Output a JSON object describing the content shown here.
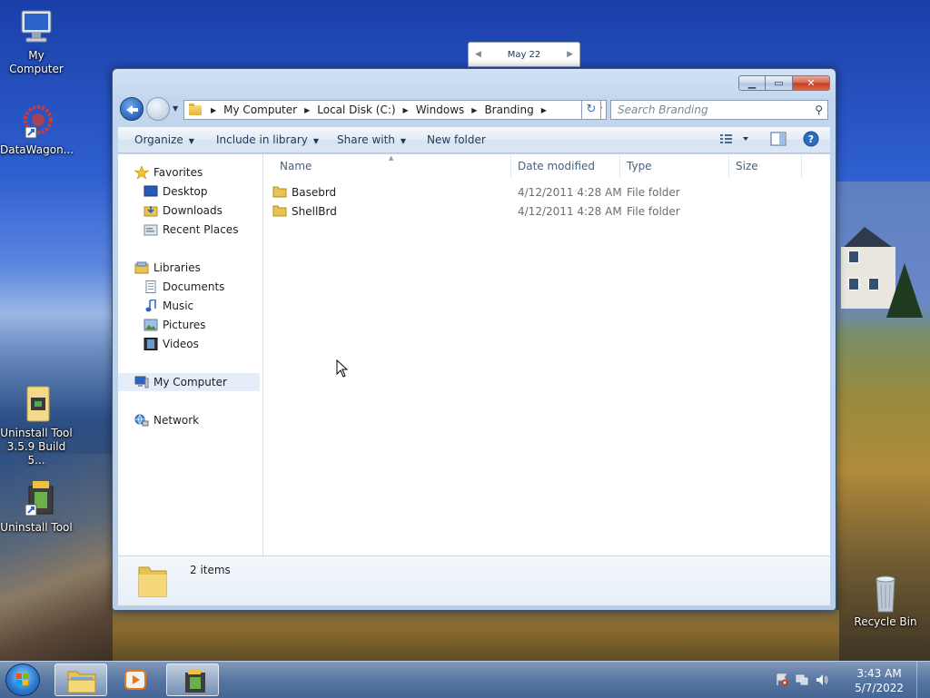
{
  "desktop": {
    "icons": [
      {
        "label": "My Computer"
      },
      {
        "label": "DataWagon..."
      },
      {
        "label": "Uninstall Tool 3.5.9 Build 5..."
      },
      {
        "label": "Uninstall Tool"
      },
      {
        "label": "Recycle Bin"
      }
    ]
  },
  "calendar": {
    "month": "May 22"
  },
  "window": {
    "breadcrumb": [
      "My Computer",
      "Local Disk (C:)",
      "Windows",
      "Branding"
    ],
    "search_placeholder": "Search Branding",
    "toolbar": {
      "organize": "Organize",
      "include_in_library": "Include in library",
      "share_with": "Share with",
      "new_folder": "New folder"
    },
    "nav": {
      "favorites": "Favorites",
      "desktop": "Desktop",
      "downloads": "Downloads",
      "recent_places": "Recent Places",
      "libraries": "Libraries",
      "documents": "Documents",
      "music": "Music",
      "pictures": "Pictures",
      "videos": "Videos",
      "my_computer": "My Computer",
      "network": "Network"
    },
    "columns": [
      "Name",
      "Date modified",
      "Type",
      "Size"
    ],
    "files": [
      {
        "name": "Basebrd",
        "date": "4/12/2011 4:28 AM",
        "type": "File folder"
      },
      {
        "name": "ShellBrd",
        "date": "4/12/2011 4:28 AM",
        "type": "File folder"
      }
    ],
    "status": "2 items"
  },
  "taskbar": {
    "time": "3:43 AM",
    "date": "5/7/2022"
  },
  "colors": {
    "accent": "#2a64b8",
    "folder": "#e2b43a"
  }
}
